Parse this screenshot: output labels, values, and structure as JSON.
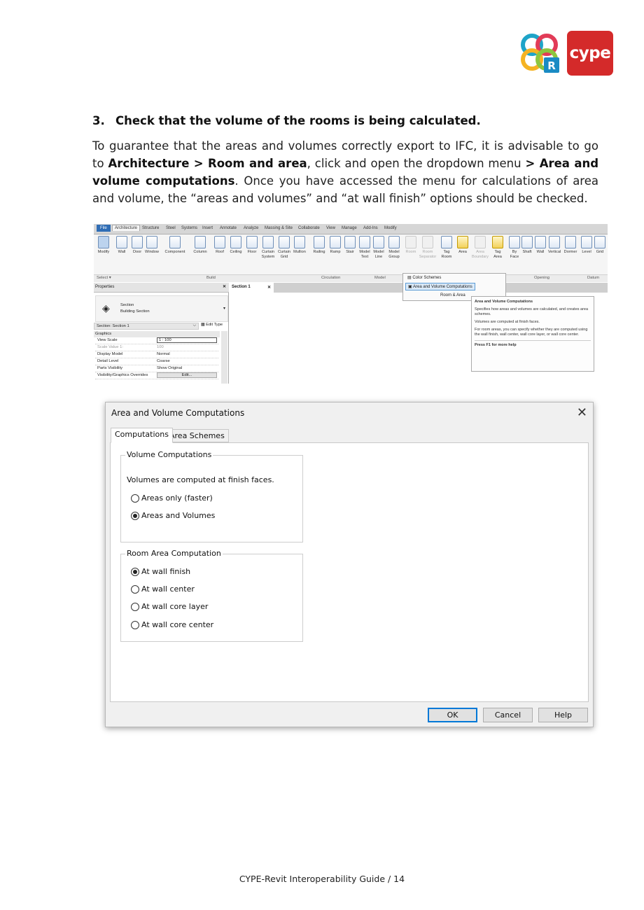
{
  "brand": {
    "cype_logo_text": "cype",
    "cype_color": "#d42a2a",
    "rvt_badge_letter": "R"
  },
  "section": {
    "number": "3.",
    "title": "Check that the volume of the rooms is being calculated.",
    "para_1": "To guarantee that the areas and volumes correctly export to IFC, it is advisable to go to ",
    "para_b1": "Architecture > Room and area",
    "para_2": ", click and open the dropdown menu ",
    "para_b2": "> Area and volume computations",
    "para_3": ". Once you have accessed the menu for calculations of area and volume, the “areas and volumes” and “at wall finish” options should be checked."
  },
  "ribbon": {
    "tabs": [
      "File",
      "Architecture",
      "Structure",
      "Steel",
      "Systems",
      "Insert",
      "Annotate",
      "Analyze",
      "Massing & Site",
      "Collaborate",
      "View",
      "Manage",
      "Add-Ins",
      "Modify"
    ],
    "tools": [
      {
        "label": "Modify",
        "label2": ""
      },
      {
        "label": "Wall",
        "label2": ""
      },
      {
        "label": "Door",
        "label2": ""
      },
      {
        "label": "Window",
        "label2": ""
      },
      {
        "label": "Component",
        "label2": ""
      },
      {
        "label": "Column",
        "label2": ""
      },
      {
        "label": "Roof",
        "label2": ""
      },
      {
        "label": "Ceiling",
        "label2": ""
      },
      {
        "label": "Floor",
        "label2": ""
      },
      {
        "label": "Curtain",
        "label2": "System"
      },
      {
        "label": "Curtain",
        "label2": "Grid"
      },
      {
        "label": "Mullion",
        "label2": ""
      },
      {
        "label": "Railing",
        "label2": ""
      },
      {
        "label": "Ramp",
        "label2": ""
      },
      {
        "label": "Stair",
        "label2": ""
      },
      {
        "label": "Model",
        "label2": "Text"
      },
      {
        "label": "Model",
        "label2": "Line"
      },
      {
        "label": "Model",
        "label2": "Group"
      },
      {
        "label": "Room",
        "label2": ""
      },
      {
        "label": "Room",
        "label2": "Separator"
      },
      {
        "label": "Tag",
        "label2": "Room"
      },
      {
        "label": "Area",
        "label2": ""
      },
      {
        "label": "Area",
        "label2": "Boundary"
      },
      {
        "label": "Tag",
        "label2": "Area"
      },
      {
        "label": "By",
        "label2": "Face"
      },
      {
        "label": "Shaft",
        "label2": ""
      },
      {
        "label": "Wall",
        "label2": ""
      },
      {
        "label": "Vertical",
        "label2": ""
      },
      {
        "label": "Dormer",
        "label2": ""
      },
      {
        "label": "Level",
        "label2": ""
      },
      {
        "label": "Grid",
        "label2": ""
      }
    ],
    "panels": [
      "Select ▾",
      "Build",
      "Circulation",
      "Model",
      "Opening",
      "Datum"
    ],
    "dropdown_items": [
      "Color Schemes",
      "Area and Volume Computations",
      "Room & Area"
    ],
    "properties_title": "Properties",
    "view_tab": "Section 1",
    "type_name": "Section",
    "type_sub": "Building Section",
    "instance_selector": "Section: Section 1",
    "edit_type": "Edit Type",
    "group": "Graphics",
    "props": [
      {
        "k": "View Scale",
        "v": "1 : 100"
      },
      {
        "k": "Scale Value    1:",
        "v": "100"
      },
      {
        "k": "Display Model",
        "v": "Normal"
      },
      {
        "k": "Detail Level",
        "v": "Coarse"
      },
      {
        "k": "Parts Visibility",
        "v": "Show Original"
      },
      {
        "k": "Visibility/Graphics Overrides",
        "v": "Edit..."
      }
    ],
    "tooltip": {
      "title": "Area and Volume Computations",
      "p1": "Specifies how areas and volumes are calculated, and creates area schemes.",
      "p2": "Volumes are computed at finish faces.",
      "p3": "For room areas, you can specify whether they are computed using the wall finish, wall center, wall core layer, or wall core center.",
      "help": "Press F1 for more help"
    }
  },
  "dialog": {
    "title": "Area and Volume Computations",
    "close": "✕",
    "tabs": [
      "Computations",
      "Area Schemes"
    ],
    "volume_group": "Volume Computations",
    "volume_note": "Volumes are computed at finish faces.",
    "volume_options": [
      {
        "label": "Areas only (faster)",
        "checked": false
      },
      {
        "label": "Areas and Volumes",
        "checked": true
      }
    ],
    "room_group": "Room Area Computation",
    "room_options": [
      {
        "label": "At wall finish",
        "checked": true
      },
      {
        "label": "At wall center",
        "checked": false
      },
      {
        "label": "At wall core layer",
        "checked": false
      },
      {
        "label": "At wall core center",
        "checked": false
      }
    ],
    "buttons": {
      "ok": "OK",
      "cancel": "Cancel",
      "help": "Help"
    }
  },
  "footer": {
    "text": "CYPE-Revit Interoperability Guide /  14"
  }
}
